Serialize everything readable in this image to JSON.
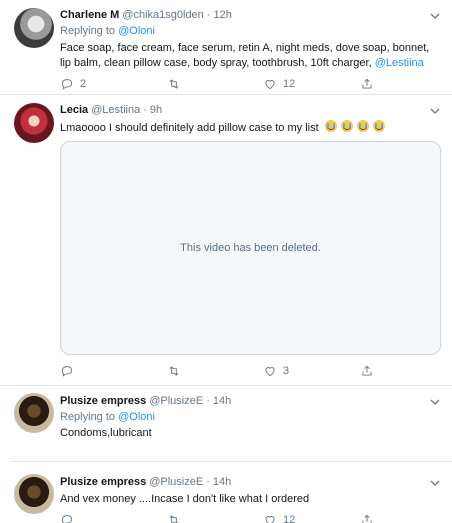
{
  "tweets": [
    {
      "name": "Charlene M",
      "handle": "@chika1sg0lden",
      "dot": "·",
      "time": "12h",
      "replying_prefix": "Replying to",
      "replying_to": "@Oloni",
      "text": "Face soap, face cream, face serum, retin A, night meds, dove soap, bonnet, lip balm, clean pillow case, body spray, toothbrush, 10ft charger,",
      "mention": "@Lestiina",
      "replies": "2",
      "retweets": "",
      "likes": "12",
      "avatar_icon": "avatar-photo"
    },
    {
      "name": "Lecia",
      "handle": "@Lestiina",
      "dot": "·",
      "time": "9h",
      "text": "Lmaoooo I should definitely add pillow case to my list",
      "emojis": [
        "loudly-crying-face-icon",
        "loudly-crying-face-icon",
        "loudly-crying-face-icon",
        "loudly-crying-face-icon"
      ],
      "video_message": "This video has been deleted.",
      "replies": "",
      "retweets": "",
      "likes": "3",
      "avatar_icon": "avatar-photo"
    },
    {
      "name": "Plusize empress",
      "handle": "@PlusizeE",
      "dot": "·",
      "time": "14h",
      "replying_prefix": "Replying to",
      "replying_to": "@Oloni",
      "text": "Condoms,lubricant",
      "avatar_icon": "avatar-photo"
    },
    {
      "name": "Plusize empress",
      "handle": "@PlusizeE",
      "dot": "·",
      "time": "14h",
      "text": "And vex money ....Incase I don't like what I ordered",
      "likes": "12",
      "avatar_icon": "avatar-photo"
    }
  ],
  "colors": {
    "link": "#1b95e0",
    "muted": "#657786",
    "border": "#e1e8ed"
  }
}
